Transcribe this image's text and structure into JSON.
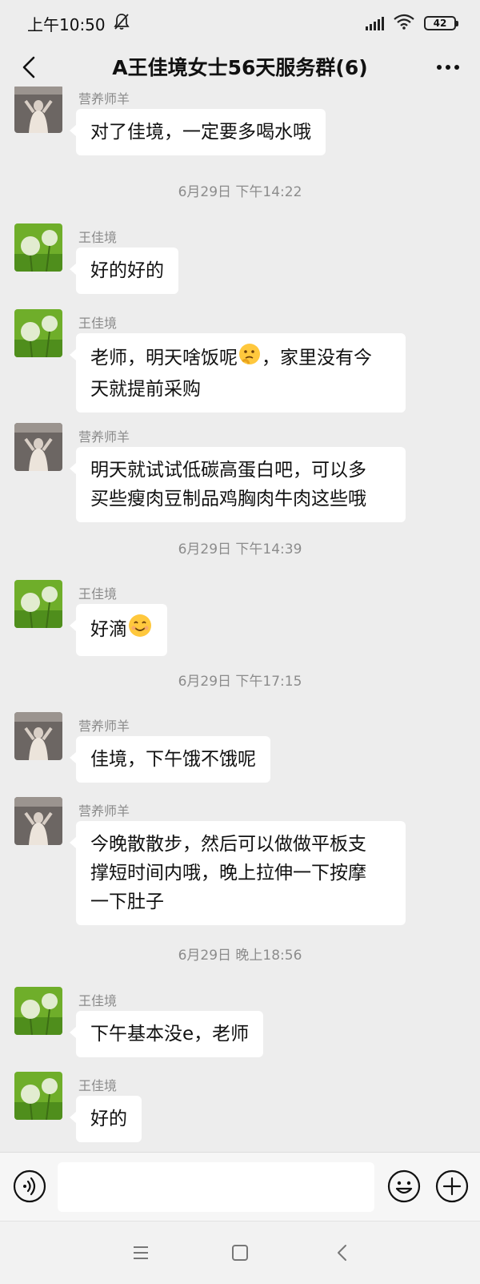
{
  "status_bar": {
    "time": "上午10:50",
    "battery": "42",
    "icons": [
      "bell-off-icon",
      "signal-icon",
      "wifi-icon",
      "battery-icon"
    ]
  },
  "header": {
    "title": "A王佳境女士56天服务群(6)",
    "icons": [
      "back-arrow-icon",
      "more-icon"
    ]
  },
  "messages": {
    "m0": {
      "sender": "营养师羊",
      "lines": [
        "对了佳境，一定要多喝水哦"
      ]
    },
    "ts1": "6月29日 下午14:22",
    "m1": {
      "sender": "王佳境",
      "lines": [
        "好的好的"
      ]
    },
    "m2": {
      "sender": "王佳境",
      "line1_a": "老师，明天啥饭呢",
      "line1_b": "，家里没有今",
      "line2": "天就提前采购",
      "emoji": "thinking-face-emoji"
    },
    "m3": {
      "sender": "营养师羊",
      "lines": [
        "明天就试试低碳高蛋白吧，可以多",
        "买些瘦肉豆制品鸡胸肉牛肉这些哦"
      ]
    },
    "ts2": "6月29日 下午14:39",
    "m4": {
      "sender": "王佳境",
      "text": "好滴",
      "emoji": "smiling-face-emoji"
    },
    "ts3": "6月29日 下午17:15",
    "m5": {
      "sender": "营养师羊",
      "lines": [
        "佳境，下午饿不饿呢"
      ]
    },
    "m6": {
      "sender": "营养师羊",
      "lines": [
        "今晚散散步，然后可以做做平板支",
        "撑短时间内哦，晚上拉伸一下按摩",
        "一下肚子"
      ]
    },
    "ts4": "6月29日 晚上18:56",
    "m7": {
      "sender": "王佳境",
      "lines": [
        "下午基本没e，老师"
      ]
    },
    "m8": {
      "sender": "王佳境",
      "lines": [
        "好的"
      ]
    }
  },
  "input_bar": {
    "value": "",
    "icons": [
      "voice-icon",
      "emoji-icon",
      "plus-icon"
    ]
  },
  "nav_bar": {
    "icons": [
      "menu-icon",
      "home-icon",
      "back-icon"
    ]
  },
  "colors": {
    "background": "#ededed",
    "bubble": "#ffffff",
    "muted_text": "#8c8c8c"
  }
}
